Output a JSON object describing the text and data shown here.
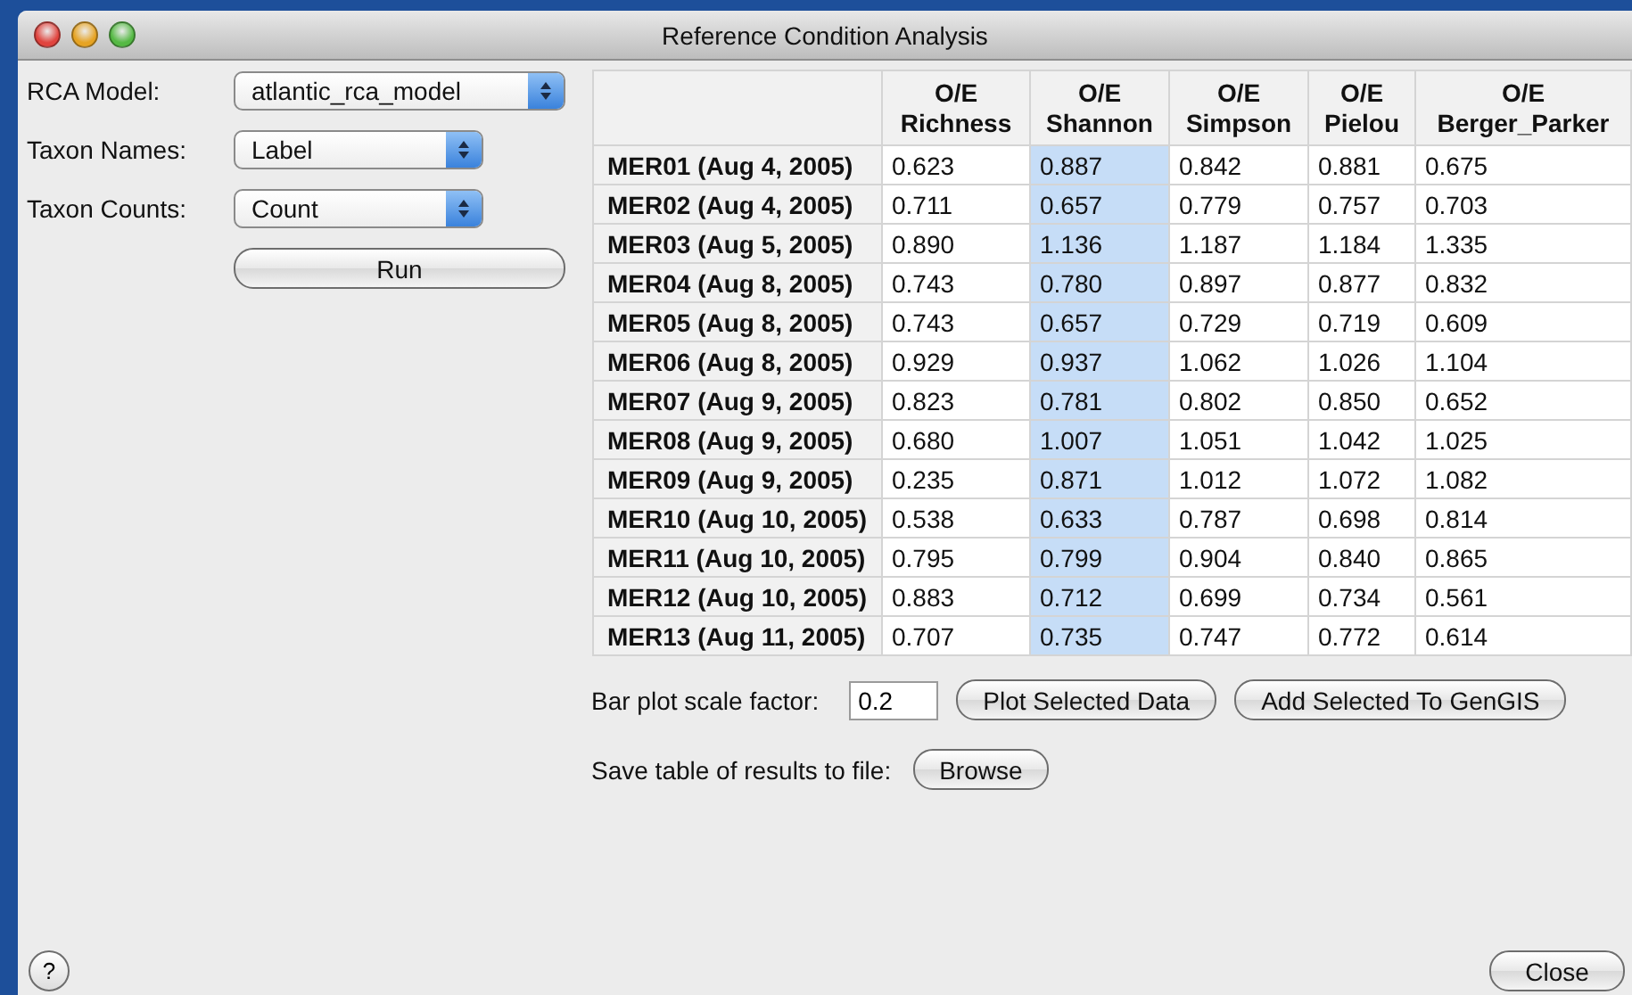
{
  "window": {
    "title": "Reference Condition Analysis"
  },
  "settings": [
    {
      "label": "RCA Model:",
      "value": "atlantic_rca_model",
      "wide": true
    },
    {
      "label": "Taxon Names:",
      "value": "Label",
      "wide": false
    },
    {
      "label": "Taxon Counts:",
      "value": "Count",
      "wide": false
    }
  ],
  "run_button": "Run",
  "table": {
    "columns": [
      {
        "label": "O/E\nRichness",
        "selected": false
      },
      {
        "label": "O/E\nShannon",
        "selected": true
      },
      {
        "label": "O/E\nSimpson",
        "selected": false
      },
      {
        "label": "O/E\nPielou",
        "selected": false
      },
      {
        "label": "O/E\nBerger_Parker",
        "selected": false
      }
    ],
    "rows": [
      {
        "label": "MER01 (Aug 4, 2005)",
        "values": [
          "0.623",
          "0.887",
          "0.842",
          "0.881",
          "0.675"
        ]
      },
      {
        "label": "MER02 (Aug 4, 2005)",
        "values": [
          "0.711",
          "0.657",
          "0.779",
          "0.757",
          "0.703"
        ]
      },
      {
        "label": "MER03 (Aug 5, 2005)",
        "values": [
          "0.890",
          "1.136",
          "1.187",
          "1.184",
          "1.335"
        ]
      },
      {
        "label": "MER04 (Aug 8, 2005)",
        "values": [
          "0.743",
          "0.780",
          "0.897",
          "0.877",
          "0.832"
        ]
      },
      {
        "label": "MER05 (Aug 8, 2005)",
        "values": [
          "0.743",
          "0.657",
          "0.729",
          "0.719",
          "0.609"
        ]
      },
      {
        "label": "MER06 (Aug 8, 2005)",
        "values": [
          "0.929",
          "0.937",
          "1.062",
          "1.026",
          "1.104"
        ]
      },
      {
        "label": "MER07 (Aug 9, 2005)",
        "values": [
          "0.823",
          "0.781",
          "0.802",
          "0.850",
          "0.652"
        ]
      },
      {
        "label": "MER08 (Aug 9, 2005)",
        "values": [
          "0.680",
          "1.007",
          "1.051",
          "1.042",
          "1.025"
        ]
      },
      {
        "label": "MER09 (Aug 9, 2005)",
        "values": [
          "0.235",
          "0.871",
          "1.012",
          "1.072",
          "1.082"
        ]
      },
      {
        "label": "MER10 (Aug 10, 2005)",
        "values": [
          "0.538",
          "0.633",
          "0.787",
          "0.698",
          "0.814"
        ]
      },
      {
        "label": "MER11 (Aug 10, 2005)",
        "values": [
          "0.795",
          "0.799",
          "0.904",
          "0.840",
          "0.865"
        ]
      },
      {
        "label": "MER12 (Aug 10, 2005)",
        "values": [
          "0.883",
          "0.712",
          "0.699",
          "0.734",
          "0.561"
        ]
      },
      {
        "label": "MER13 (Aug 11, 2005)",
        "values": [
          "0.707",
          "0.735",
          "0.747",
          "0.772",
          "0.614"
        ]
      }
    ]
  },
  "scale_factor": {
    "label": "Bar plot scale factor:",
    "value": "0.2"
  },
  "buttons": [
    "Plot Selected Data",
    "Add Selected To GenGIS"
  ],
  "save": {
    "label": "Save table of results to file:",
    "button": "Browse"
  },
  "help_button": "?",
  "close_button": "Close"
}
